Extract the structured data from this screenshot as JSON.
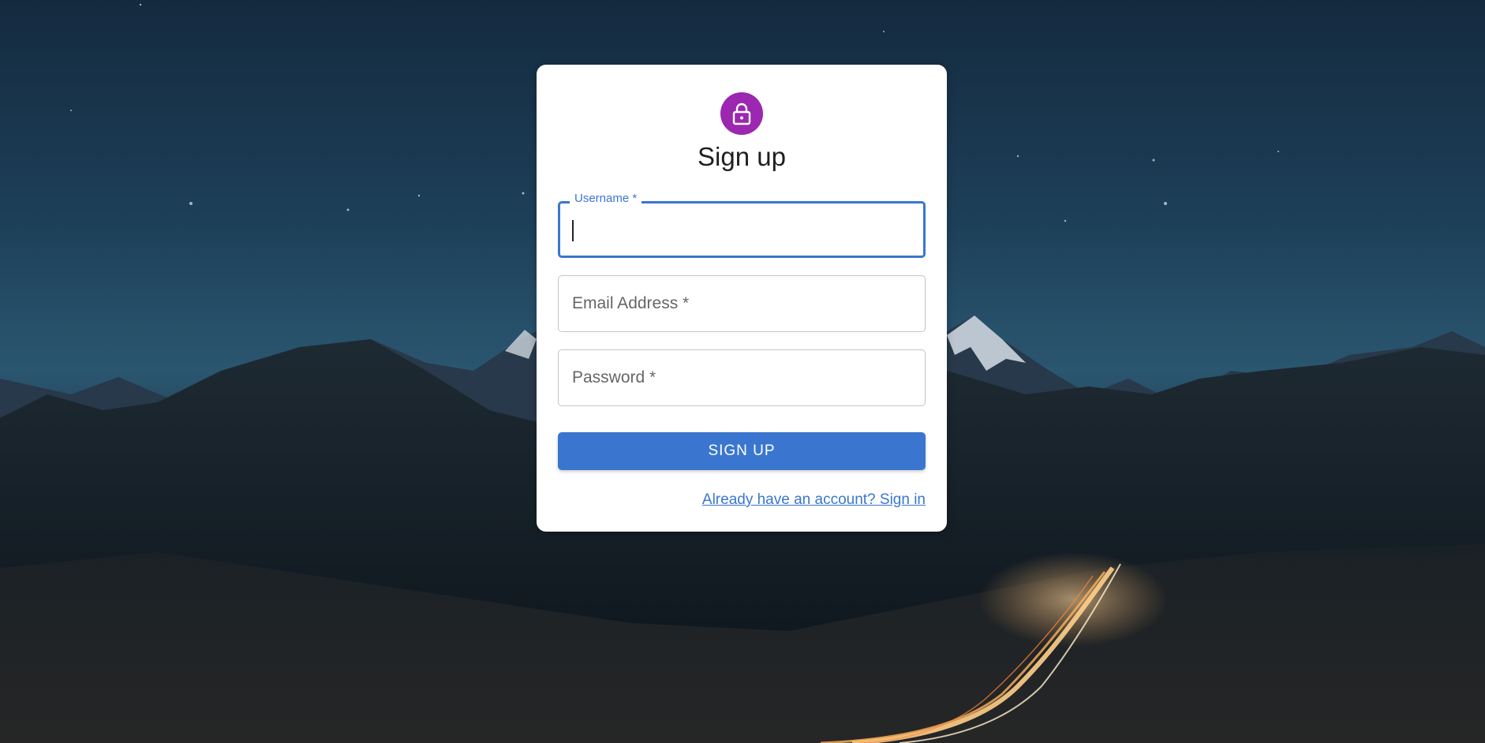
{
  "form": {
    "title": "Sign up",
    "avatar_icon": "lock-icon",
    "avatar_color": "#9c27b0",
    "accent_color": "#3a76cf",
    "fields": {
      "username": {
        "label": "Username *",
        "value": ""
      },
      "email": {
        "label": "Email Address *",
        "value": ""
      },
      "password": {
        "label": "Password *",
        "value": ""
      }
    },
    "submit_label": "SIGN UP",
    "signin_link": "Already have an account? Sign in"
  }
}
